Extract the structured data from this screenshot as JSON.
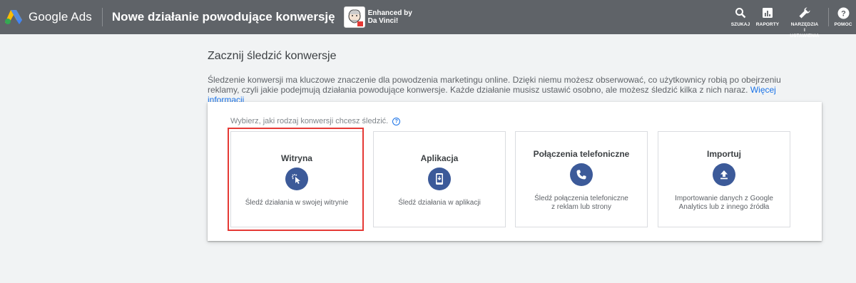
{
  "header": {
    "product_name": "Google Ads",
    "page_title": "Nowe działanie powodujące konwersję",
    "extension_text_line1": "Enhanced by",
    "extension_text_line2": "Da Vinci!",
    "actions": {
      "search": "SZUKAJ",
      "reports": "RAPORTY",
      "tools_line1": "NARZĘDZIA",
      "tools_line2": "I",
      "tools_line3": "USTAWIENIA",
      "help": "POMOC"
    }
  },
  "main": {
    "title": "Zacznij śledzić konwersje",
    "description": "Śledzenie konwersji ma kluczowe znaczenie dla powodzenia marketingu online. Dzięki niemu możesz obserwować, co użytkownicy robią po obejrzeniu reklamy, czyli jakie podejmują działania powodujące konwersje. Każde działanie musisz ustawić osobno, ale możesz śledzić kilka z nich naraz.",
    "learn_more": "Więcej informacji",
    "prompt": "Wybierz, jaki rodzaj konwersji chcesz śledzić.",
    "help_icon": "?",
    "cards": [
      {
        "title": "Witryna",
        "icon": "cursor-click-icon",
        "description": "Śledź działania w swojej witrynie"
      },
      {
        "title": "Aplikacja",
        "icon": "mobile-app-icon",
        "description": "Śledź działania w aplikacji"
      },
      {
        "title": "Połączenia telefoniczne",
        "icon": "phone-icon",
        "description_line1": "Śledź połączenia telefoniczne",
        "description_line2": "z reklam lub strony"
      },
      {
        "title": "Importuj",
        "icon": "upload-icon",
        "description_line1": "Importowanie danych z Google",
        "description_line2": "Analytics lub z innego źródła"
      }
    ]
  },
  "colors": {
    "topbar": "#5f6368",
    "icon_circle": "#3c5a99",
    "link": "#1a73e8",
    "selection": "#e53935"
  }
}
